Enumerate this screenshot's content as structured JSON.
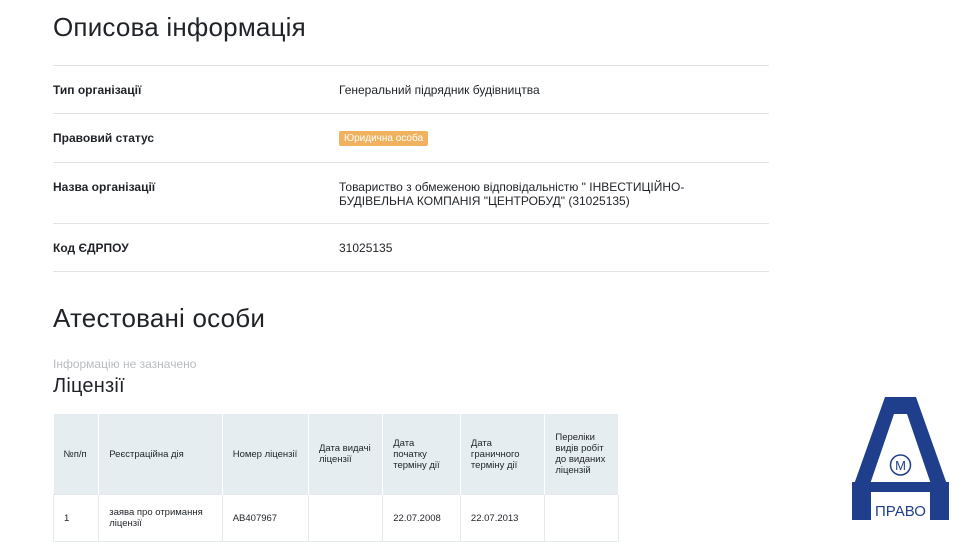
{
  "description_section": {
    "title": "Описова інформація",
    "rows": [
      {
        "label": "Тип організації",
        "value": "Генеральний підрядник будівництва"
      },
      {
        "label": "Правовий статус",
        "badge": "Юридична особа"
      },
      {
        "label": "Назва організації",
        "value": "Товариство з обмеженою відповідальністю \" ІНВЕСТИЦІЙНО-БУДІВЕЛЬНА КОМПАНІЯ \"ЦЕНТРОБУД\" (31025135)"
      },
      {
        "label": "Код ЄДРПОУ",
        "value": "31025135"
      }
    ]
  },
  "certified_section": {
    "title": "Атестовані особи",
    "empty_text": "Інформацію не зазначено"
  },
  "licenses_section": {
    "title": "Ліцензії",
    "headers": [
      "№п/п",
      "Реєстраційна дія",
      "Номер ліцензії",
      "Дата видачі ліцензії",
      "Дата початку терміну дії",
      "Дата граничного терміну дії",
      "Переліки видів робіт до виданих ліцензій"
    ],
    "rows": [
      {
        "num": "1",
        "action": "заява про отримання ліцензії",
        "number": "АВ407967",
        "issue_date": "",
        "start_date": "22.07.2008",
        "end_date": "22.07.2013",
        "works": ""
      }
    ]
  },
  "logo": {
    "letter": "А",
    "circle_letter": "М",
    "caption": "ПРАВО",
    "color": "#1f3e8c"
  }
}
